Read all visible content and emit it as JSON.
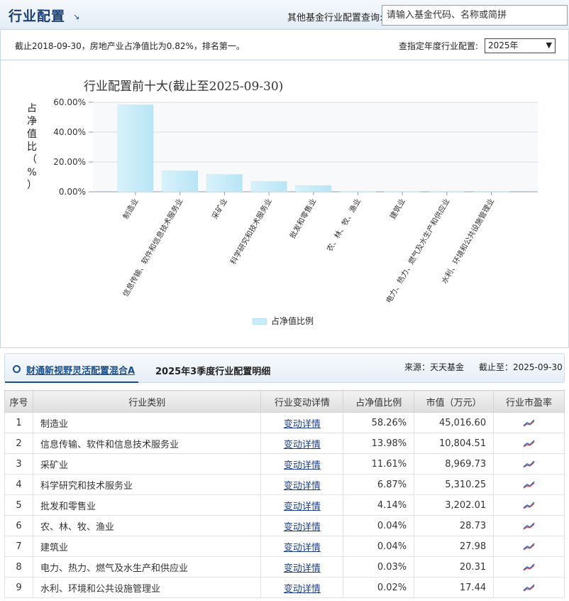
{
  "header": {
    "title": "行业配置",
    "search_label": "其他基金行业配置查询:",
    "search_placeholder": "请输入基金代码、名称或简拼"
  },
  "info": {
    "text": "截止2018-09-30，房地产业占净值比为0.82%，排名第一。",
    "year_label": "查指定年度行业配置:",
    "year_selected": "2025年"
  },
  "chart_data": {
    "type": "bar",
    "title": "行业配置前十大(截止至2025-09-30)",
    "ylabel": "占净值比（%）",
    "ylim": [
      0,
      60
    ],
    "yticks": [
      "0.00%",
      "20.00%",
      "40.00%",
      "60.00%"
    ],
    "grid": true,
    "legend": "bottom",
    "categories": [
      "制造业",
      "信息传输、软件和信息技术服务业",
      "采矿业",
      "科学研究和技术服务业",
      "批发和零售业",
      "农、林、牧、渔业",
      "建筑业",
      "电力、热力、燃气及水生产和供应业",
      "水利、环境和公共设施管理业"
    ],
    "series": [
      {
        "name": "占净值比例",
        "color": "#c9ecf8",
        "values": [
          58.26,
          13.98,
          11.61,
          6.87,
          4.14,
          0.04,
          0.04,
          0.03,
          0.02
        ]
      }
    ]
  },
  "detail": {
    "fund_name": "财通新视野灵活配置混合A",
    "description": "2025年3季度行业配置明细",
    "source": "来源：天天基金",
    "as_of": "截止至：2025-09-30"
  },
  "table": {
    "headers": [
      "序号",
      "行业类别",
      "行业变动详情",
      "占净值比例",
      "市值（万元）",
      "行业市盈率"
    ],
    "link_text": "变动详情",
    "rows": [
      {
        "no": "1",
        "industry": "制造业",
        "ratio": "58.26%",
        "value": "45,016.60"
      },
      {
        "no": "2",
        "industry": "信息传输、软件和信息技术服务业",
        "ratio": "13.98%",
        "value": "10,804.51"
      },
      {
        "no": "3",
        "industry": "采矿业",
        "ratio": "11.61%",
        "value": "8,969.73"
      },
      {
        "no": "4",
        "industry": "科学研究和技术服务业",
        "ratio": "6.87%",
        "value": "5,310.25"
      },
      {
        "no": "5",
        "industry": "批发和零售业",
        "ratio": "4.14%",
        "value": "3,202.01"
      },
      {
        "no": "6",
        "industry": "农、林、牧、渔业",
        "ratio": "0.04%",
        "value": "28.73"
      },
      {
        "no": "7",
        "industry": "建筑业",
        "ratio": "0.04%",
        "value": "27.98"
      },
      {
        "no": "8",
        "industry": "电力、热力、燃气及水生产和供应业",
        "ratio": "0.03%",
        "value": "20.31"
      },
      {
        "no": "9",
        "industry": "水利、环境和公共设施管理业",
        "ratio": "0.02%",
        "value": "17.44"
      }
    ]
  }
}
